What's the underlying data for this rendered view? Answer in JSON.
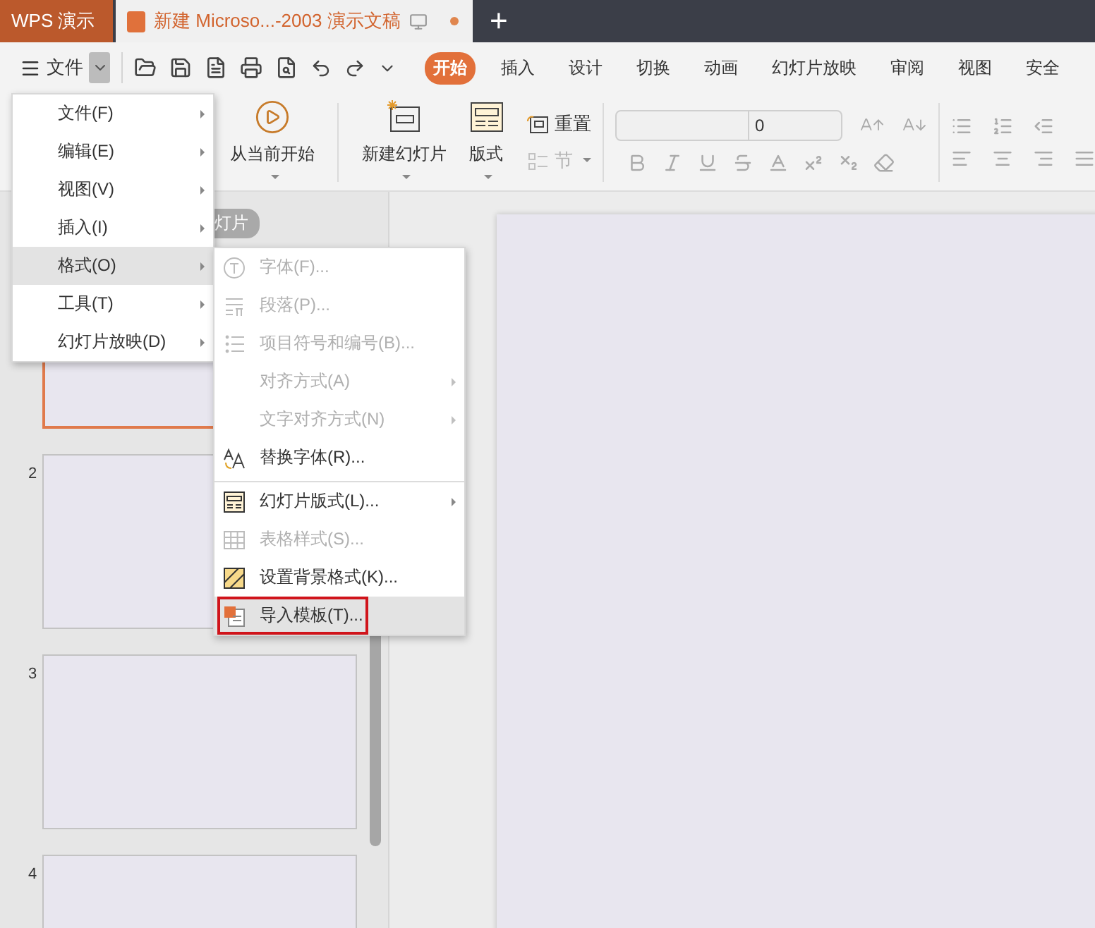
{
  "title_bar": {
    "app_tab": "WPS 演示",
    "document_tab": {
      "title": "新建 Microso...-2003 演示文稿",
      "unsaved": true
    },
    "new_tab": "+"
  },
  "menu_bar": {
    "menu_button": "文件",
    "menu_open": true,
    "tabs": [
      {
        "label": "开始",
        "selected": true
      },
      {
        "label": "插入",
        "selected": false
      },
      {
        "label": "设计",
        "selected": false
      },
      {
        "label": "切换",
        "selected": false
      },
      {
        "label": "动画",
        "selected": false
      },
      {
        "label": "幻灯片放映",
        "selected": false
      },
      {
        "label": "审阅",
        "selected": false
      },
      {
        "label": "视图",
        "selected": false
      },
      {
        "label": "安全",
        "selected": false
      }
    ]
  },
  "ribbon": {
    "play_from_current": "从当前开始",
    "new_slide": "新建幻灯片",
    "layout": "版式",
    "reset": "重置",
    "section": {
      "label": "节",
      "disabled": true
    },
    "font_size": "0"
  },
  "slide_panel": {
    "header_pill": "灯片",
    "thumbnails": [
      {
        "selected": true
      },
      {
        "number": "2",
        "selected": false
      },
      {
        "number": "3",
        "selected": false
      },
      {
        "number": "4",
        "selected": false
      }
    ]
  },
  "main_menu": {
    "items": [
      {
        "label": "文件(F)",
        "selected": false,
        "has_submenu": true
      },
      {
        "label": "编辑(E)",
        "selected": false,
        "has_submenu": true
      },
      {
        "label": "视图(V)",
        "selected": false,
        "has_submenu": true
      },
      {
        "label": "插入(I)",
        "selected": false,
        "has_submenu": true
      },
      {
        "label": "格式(O)",
        "selected": true,
        "has_submenu": true
      },
      {
        "label": "工具(T)",
        "selected": false,
        "has_submenu": true
      },
      {
        "label": "幻灯片放映(D)",
        "selected": false,
        "has_submenu": true
      }
    ]
  },
  "format_submenu": {
    "items": [
      {
        "kind": "font",
        "label": "字体(F)...",
        "disabled": true,
        "selected": false,
        "has_submenu": false,
        "separator_before": false,
        "outlined": false
      },
      {
        "kind": "paragraph",
        "label": "段落(P)...",
        "disabled": true,
        "selected": false,
        "has_submenu": false,
        "separator_before": false,
        "outlined": false
      },
      {
        "kind": "bullets",
        "label": "项目符号和编号(B)...",
        "disabled": true,
        "selected": false,
        "has_submenu": false,
        "separator_before": false,
        "outlined": false
      },
      {
        "kind": "plain",
        "label": "对齐方式(A)",
        "disabled": true,
        "selected": false,
        "has_submenu": true,
        "separator_before": false,
        "outlined": false
      },
      {
        "kind": "plain",
        "label": "文字对齐方式(N)",
        "disabled": true,
        "selected": false,
        "has_submenu": true,
        "separator_before": false,
        "outlined": false
      },
      {
        "kind": "replace",
        "label": "替换字体(R)...",
        "disabled": false,
        "selected": false,
        "has_submenu": false,
        "separator_before": false,
        "outlined": false
      },
      {
        "kind": "layout",
        "label": "幻灯片版式(L)...",
        "disabled": false,
        "selected": false,
        "has_submenu": true,
        "separator_before": true,
        "outlined": false
      },
      {
        "kind": "table",
        "label": "表格样式(S)...",
        "disabled": true,
        "selected": false,
        "has_submenu": false,
        "separator_before": false,
        "outlined": false
      },
      {
        "kind": "background",
        "label": "设置背景格式(K)...",
        "disabled": false,
        "selected": false,
        "has_submenu": false,
        "separator_before": false,
        "outlined": false
      },
      {
        "kind": "template",
        "label": "导入模板(T)...",
        "disabled": false,
        "selected": true,
        "has_submenu": false,
        "separator_before": false,
        "outlined": true
      }
    ]
  }
}
